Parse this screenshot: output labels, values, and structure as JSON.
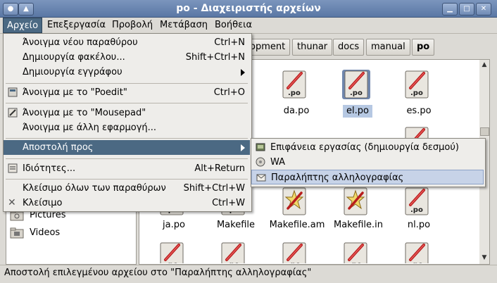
{
  "window": {
    "title": "po - Διαχειριστής αρχείων"
  },
  "menubar": {
    "items": [
      "Αρχείο",
      "Επεξεργασία",
      "Προβολή",
      "Μετάβαση",
      "Βοήθεια"
    ]
  },
  "path_buttons": [
    "opment",
    "thunar",
    "docs",
    "manual",
    "po"
  ],
  "side_panel": {
    "items": [
      {
        "label": "Pictures",
        "icon": "folder-pictures-icon"
      },
      {
        "label": "Videos",
        "icon": "folder-videos-icon"
      }
    ]
  },
  "files": {
    "row1": [
      "da.po",
      "el.po",
      "es.po"
    ],
    "row3": [
      "ja.po",
      "Makefile",
      "Makefile.am",
      "Makefile.in",
      "nl.po"
    ]
  },
  "file_menu": {
    "items": [
      {
        "label": "Άνοιγμα νέου παραθύρου",
        "accel": "Ctrl+N"
      },
      {
        "label": "Δημιουργία φακέλου...",
        "accel": "Shift+Ctrl+N"
      },
      {
        "label": "Δημιουργία εγγράφου",
        "accel": ""
      },
      {
        "label": "Άνοιγμα με το \"Poedit\"",
        "accel": "Ctrl+O"
      },
      {
        "label": "Άνοιγμα με το \"Mousepad\"",
        "accel": ""
      },
      {
        "label": "Άνοιγμα με άλλη εφαρμογή...",
        "accel": ""
      },
      {
        "label": "Αποστολή προς",
        "accel": ""
      },
      {
        "label": "Ιδιότητες...",
        "accel": "Alt+Return"
      },
      {
        "label": "Κλείσιμο όλων των παραθύρων",
        "accel": "Shift+Ctrl+W"
      },
      {
        "label": "Κλείσιμο",
        "accel": "Ctrl+W"
      }
    ]
  },
  "sendto_menu": {
    "items": [
      {
        "label": "Επιφάνεια εργασίας (δημιουργία δεσμού)"
      },
      {
        "label": "WA"
      },
      {
        "label": "Παραλήπτης αλληλογραφίας"
      }
    ]
  },
  "statusbar": {
    "text": "Αποστολή επιλεγμένου αρχείου στο \"Παραλήπτης αλληλογραφίας\""
  },
  "colors": {
    "highlight": "#4b6983",
    "selection_label": "#b6c8e2"
  }
}
